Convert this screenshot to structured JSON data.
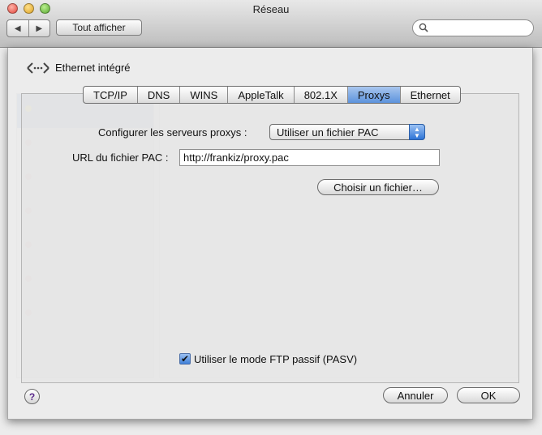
{
  "window": {
    "title": "Réseau"
  },
  "toolbar": {
    "show_all_label": "Tout afficher",
    "back_icon": "chevron-left-icon",
    "forward_icon": "chevron-right-icon",
    "search_placeholder": ""
  },
  "sheet": {
    "interface_name": "Ethernet intégré",
    "interface_icon": "ethernet-icon",
    "tabs": [
      {
        "label": "TCP/IP",
        "active": false
      },
      {
        "label": "DNS",
        "active": false
      },
      {
        "label": "WINS",
        "active": false
      },
      {
        "label": "AppleTalk",
        "active": false
      },
      {
        "label": "802.1X",
        "active": false
      },
      {
        "label": "Proxys",
        "active": true
      },
      {
        "label": "Ethernet",
        "active": false
      }
    ],
    "configure_label": "Configurer les serveurs proxys :",
    "configure_value": "Utiliser un fichier PAC",
    "pac_url_label": "URL du fichier PAC :",
    "pac_url_value": "http://frankiz/proxy.pac",
    "choose_file_label": "Choisir un fichier…",
    "passive_ftp_label": "Utiliser le mode FTP passif (PASV)",
    "passive_ftp_checked": true,
    "cancel_label": "Annuler",
    "ok_label": "OK",
    "help_label": "?"
  },
  "colors": {
    "accent": "#3f80d9",
    "tab_active": "#5c93dd"
  }
}
